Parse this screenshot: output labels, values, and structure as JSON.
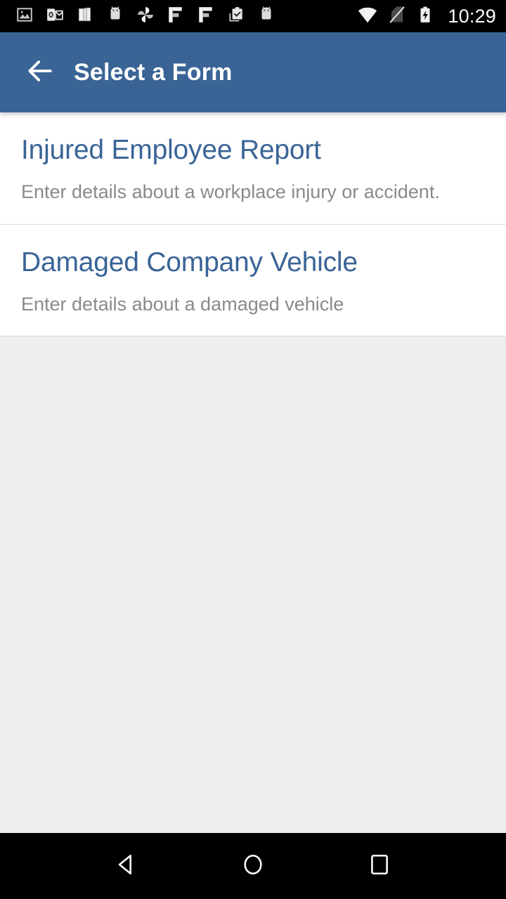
{
  "status_bar": {
    "background": "#000000",
    "time": "10:29",
    "left_icons": [
      {
        "name": "image-icon",
        "label": "image"
      },
      {
        "name": "outlook-icon",
        "label": "outlook mail"
      },
      {
        "name": "documents-stack-icon",
        "label": "documents"
      },
      {
        "name": "android-mascot-icon",
        "label": "android"
      },
      {
        "name": "pinwheel-icon",
        "label": "google photos"
      },
      {
        "name": "block-f-icon",
        "label": "app"
      },
      {
        "name": "block-f-icon-2",
        "label": "app"
      },
      {
        "name": "clipboard-check-icon",
        "label": "clipboard"
      },
      {
        "name": "android-mascot-icon-2",
        "label": "android"
      }
    ],
    "right_icons": [
      {
        "name": "wifi-icon",
        "label": "wifi"
      },
      {
        "name": "no-sim-icon",
        "label": "no signal"
      },
      {
        "name": "battery-charging-icon",
        "label": "battery charging"
      }
    ]
  },
  "app_bar": {
    "background": "#3a6496",
    "title": "Select a Form",
    "back_icon": "arrow-left-icon"
  },
  "main": {
    "background": "#eeeeee",
    "accent_color": "#3a6496",
    "description_color": "#8a8a8a",
    "forms": [
      {
        "title": "Injured Employee Report",
        "description": "Enter details about a workplace injury or accident."
      },
      {
        "title": "Damaged Company Vehicle",
        "description": "Enter details about a damaged vehicle"
      }
    ]
  },
  "nav_bar": {
    "background": "#000000",
    "buttons": [
      {
        "name": "nav-back-button",
        "label": "Back"
      },
      {
        "name": "nav-home-button",
        "label": "Home"
      },
      {
        "name": "nav-recents-button",
        "label": "Recents"
      }
    ]
  }
}
